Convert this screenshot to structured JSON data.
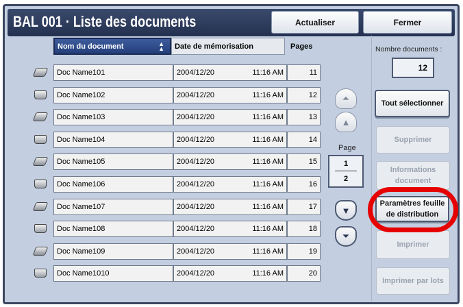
{
  "title": "BAL 001 · Liste des documents",
  "buttons": {
    "refresh": "Actualiser",
    "close": "Fermer"
  },
  "columns": {
    "name": "Nom du document",
    "date": "Date de mémorisation",
    "pages": "Pages"
  },
  "rows": [
    {
      "name": "Doc Name101",
      "date": "2004/12/20",
      "time": "11:16 AM",
      "pages": "11",
      "icon": "scanner-tray-icon"
    },
    {
      "name": "Doc Name102",
      "date": "2004/12/20",
      "time": "11:16 AM",
      "pages": "12",
      "icon": "document-box-icon"
    },
    {
      "name": "Doc Name103",
      "date": "2004/12/20",
      "time": "11:16 AM",
      "pages": "13",
      "icon": "scanner-tray-icon"
    },
    {
      "name": "Doc Name104",
      "date": "2004/12/20",
      "time": "11:16 AM",
      "pages": "14",
      "icon": "document-box-icon"
    },
    {
      "name": "Doc Name105",
      "date": "2004/12/20",
      "time": "11:16 AM",
      "pages": "15",
      "icon": "scanner-tray-icon"
    },
    {
      "name": "Doc Name106",
      "date": "2004/12/20",
      "time": "11:16 AM",
      "pages": "16",
      "icon": "document-box-icon"
    },
    {
      "name": "Doc Name107",
      "date": "2004/12/20",
      "time": "11:16 AM",
      "pages": "17",
      "icon": "scanner-tray-icon"
    },
    {
      "name": "Doc Name108",
      "date": "2004/12/20",
      "time": "11:16 AM",
      "pages": "18",
      "icon": "document-box-icon"
    },
    {
      "name": "Doc Name109",
      "date": "2004/12/20",
      "time": "11:16 AM",
      "pages": "19",
      "icon": "scanner-tray-icon"
    },
    {
      "name": "Doc Name1010",
      "date": "2004/12/20",
      "time": "11:16 AM",
      "pages": "20",
      "icon": "document-box-icon"
    }
  ],
  "pager": {
    "label": "Page",
    "current": "1",
    "total": "2"
  },
  "side": {
    "count_label": "Nombre documents :",
    "count": "12",
    "select_all": "Tout sélectionner",
    "delete": "Supprimer",
    "info": "Informations document",
    "dist_params": "Paramètres feuille de distribution",
    "print": "Imprimer",
    "batch_print": "Imprimer par lots"
  },
  "colors": {
    "highlight": "#e60000",
    "title_bg": "#2a3a5c"
  }
}
